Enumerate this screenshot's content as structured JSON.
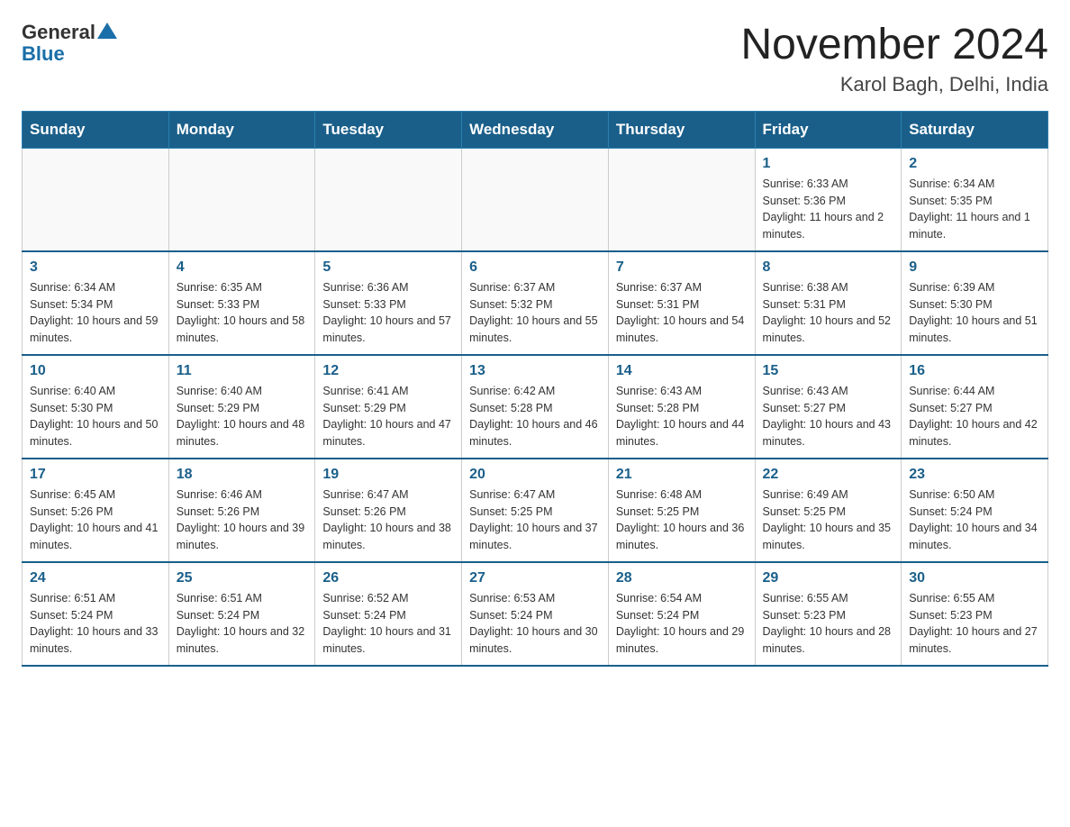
{
  "header": {
    "logo_general": "General",
    "logo_blue": "Blue",
    "title": "November 2024",
    "subtitle": "Karol Bagh, Delhi, India"
  },
  "calendar": {
    "days_of_week": [
      "Sunday",
      "Monday",
      "Tuesday",
      "Wednesday",
      "Thursday",
      "Friday",
      "Saturday"
    ],
    "weeks": [
      [
        {
          "day": "",
          "info": ""
        },
        {
          "day": "",
          "info": ""
        },
        {
          "day": "",
          "info": ""
        },
        {
          "day": "",
          "info": ""
        },
        {
          "day": "",
          "info": ""
        },
        {
          "day": "1",
          "info": "Sunrise: 6:33 AM\nSunset: 5:36 PM\nDaylight: 11 hours and 2 minutes."
        },
        {
          "day": "2",
          "info": "Sunrise: 6:34 AM\nSunset: 5:35 PM\nDaylight: 11 hours and 1 minute."
        }
      ],
      [
        {
          "day": "3",
          "info": "Sunrise: 6:34 AM\nSunset: 5:34 PM\nDaylight: 10 hours and 59 minutes."
        },
        {
          "day": "4",
          "info": "Sunrise: 6:35 AM\nSunset: 5:33 PM\nDaylight: 10 hours and 58 minutes."
        },
        {
          "day": "5",
          "info": "Sunrise: 6:36 AM\nSunset: 5:33 PM\nDaylight: 10 hours and 57 minutes."
        },
        {
          "day": "6",
          "info": "Sunrise: 6:37 AM\nSunset: 5:32 PM\nDaylight: 10 hours and 55 minutes."
        },
        {
          "day": "7",
          "info": "Sunrise: 6:37 AM\nSunset: 5:31 PM\nDaylight: 10 hours and 54 minutes."
        },
        {
          "day": "8",
          "info": "Sunrise: 6:38 AM\nSunset: 5:31 PM\nDaylight: 10 hours and 52 minutes."
        },
        {
          "day": "9",
          "info": "Sunrise: 6:39 AM\nSunset: 5:30 PM\nDaylight: 10 hours and 51 minutes."
        }
      ],
      [
        {
          "day": "10",
          "info": "Sunrise: 6:40 AM\nSunset: 5:30 PM\nDaylight: 10 hours and 50 minutes."
        },
        {
          "day": "11",
          "info": "Sunrise: 6:40 AM\nSunset: 5:29 PM\nDaylight: 10 hours and 48 minutes."
        },
        {
          "day": "12",
          "info": "Sunrise: 6:41 AM\nSunset: 5:29 PM\nDaylight: 10 hours and 47 minutes."
        },
        {
          "day": "13",
          "info": "Sunrise: 6:42 AM\nSunset: 5:28 PM\nDaylight: 10 hours and 46 minutes."
        },
        {
          "day": "14",
          "info": "Sunrise: 6:43 AM\nSunset: 5:28 PM\nDaylight: 10 hours and 44 minutes."
        },
        {
          "day": "15",
          "info": "Sunrise: 6:43 AM\nSunset: 5:27 PM\nDaylight: 10 hours and 43 minutes."
        },
        {
          "day": "16",
          "info": "Sunrise: 6:44 AM\nSunset: 5:27 PM\nDaylight: 10 hours and 42 minutes."
        }
      ],
      [
        {
          "day": "17",
          "info": "Sunrise: 6:45 AM\nSunset: 5:26 PM\nDaylight: 10 hours and 41 minutes."
        },
        {
          "day": "18",
          "info": "Sunrise: 6:46 AM\nSunset: 5:26 PM\nDaylight: 10 hours and 39 minutes."
        },
        {
          "day": "19",
          "info": "Sunrise: 6:47 AM\nSunset: 5:26 PM\nDaylight: 10 hours and 38 minutes."
        },
        {
          "day": "20",
          "info": "Sunrise: 6:47 AM\nSunset: 5:25 PM\nDaylight: 10 hours and 37 minutes."
        },
        {
          "day": "21",
          "info": "Sunrise: 6:48 AM\nSunset: 5:25 PM\nDaylight: 10 hours and 36 minutes."
        },
        {
          "day": "22",
          "info": "Sunrise: 6:49 AM\nSunset: 5:25 PM\nDaylight: 10 hours and 35 minutes."
        },
        {
          "day": "23",
          "info": "Sunrise: 6:50 AM\nSunset: 5:24 PM\nDaylight: 10 hours and 34 minutes."
        }
      ],
      [
        {
          "day": "24",
          "info": "Sunrise: 6:51 AM\nSunset: 5:24 PM\nDaylight: 10 hours and 33 minutes."
        },
        {
          "day": "25",
          "info": "Sunrise: 6:51 AM\nSunset: 5:24 PM\nDaylight: 10 hours and 32 minutes."
        },
        {
          "day": "26",
          "info": "Sunrise: 6:52 AM\nSunset: 5:24 PM\nDaylight: 10 hours and 31 minutes."
        },
        {
          "day": "27",
          "info": "Sunrise: 6:53 AM\nSunset: 5:24 PM\nDaylight: 10 hours and 30 minutes."
        },
        {
          "day": "28",
          "info": "Sunrise: 6:54 AM\nSunset: 5:24 PM\nDaylight: 10 hours and 29 minutes."
        },
        {
          "day": "29",
          "info": "Sunrise: 6:55 AM\nSunset: 5:23 PM\nDaylight: 10 hours and 28 minutes."
        },
        {
          "day": "30",
          "info": "Sunrise: 6:55 AM\nSunset: 5:23 PM\nDaylight: 10 hours and 27 minutes."
        }
      ]
    ]
  }
}
